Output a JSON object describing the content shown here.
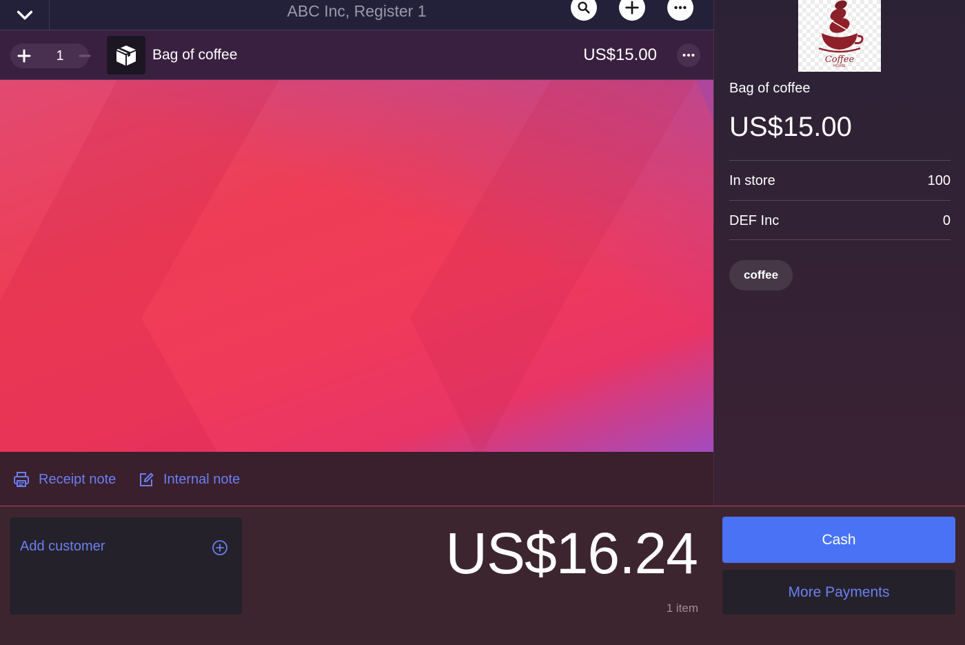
{
  "header": {
    "register_title": "ABC Inc, Register 1",
    "icons": [
      "chevron-down-icon",
      "search-icon",
      "plus-icon",
      "more-icon"
    ]
  },
  "cart": {
    "items": [
      {
        "quantity": "1",
        "name": "Bag of coffee",
        "price": "US$15.00",
        "icon": "package-icon"
      }
    ]
  },
  "notes": {
    "receipt_note_label": "Receipt note",
    "internal_note_label": "Internal note"
  },
  "product_detail": {
    "image_alt": "Coffee house logo",
    "logo_text": "Coffee",
    "logo_subtext": "HOUSE",
    "name": "Bag of coffee",
    "price": "US$15.00",
    "stock": [
      {
        "location": "In store",
        "quantity": "100"
      },
      {
        "location": "DEF Inc",
        "quantity": "0"
      }
    ],
    "tags": [
      "coffee"
    ]
  },
  "checkout": {
    "add_customer_label": "Add customer",
    "total": "US$16.24",
    "item_count": "1 item",
    "cash_label": "Cash",
    "more_payments_label": "More Payments"
  },
  "colors": {
    "accent_blue": "#4a72f5",
    "link_blue": "#6a7ff3",
    "wallpaper_red": "#f03a5a",
    "wallpaper_purple": "#a34bbf"
  }
}
